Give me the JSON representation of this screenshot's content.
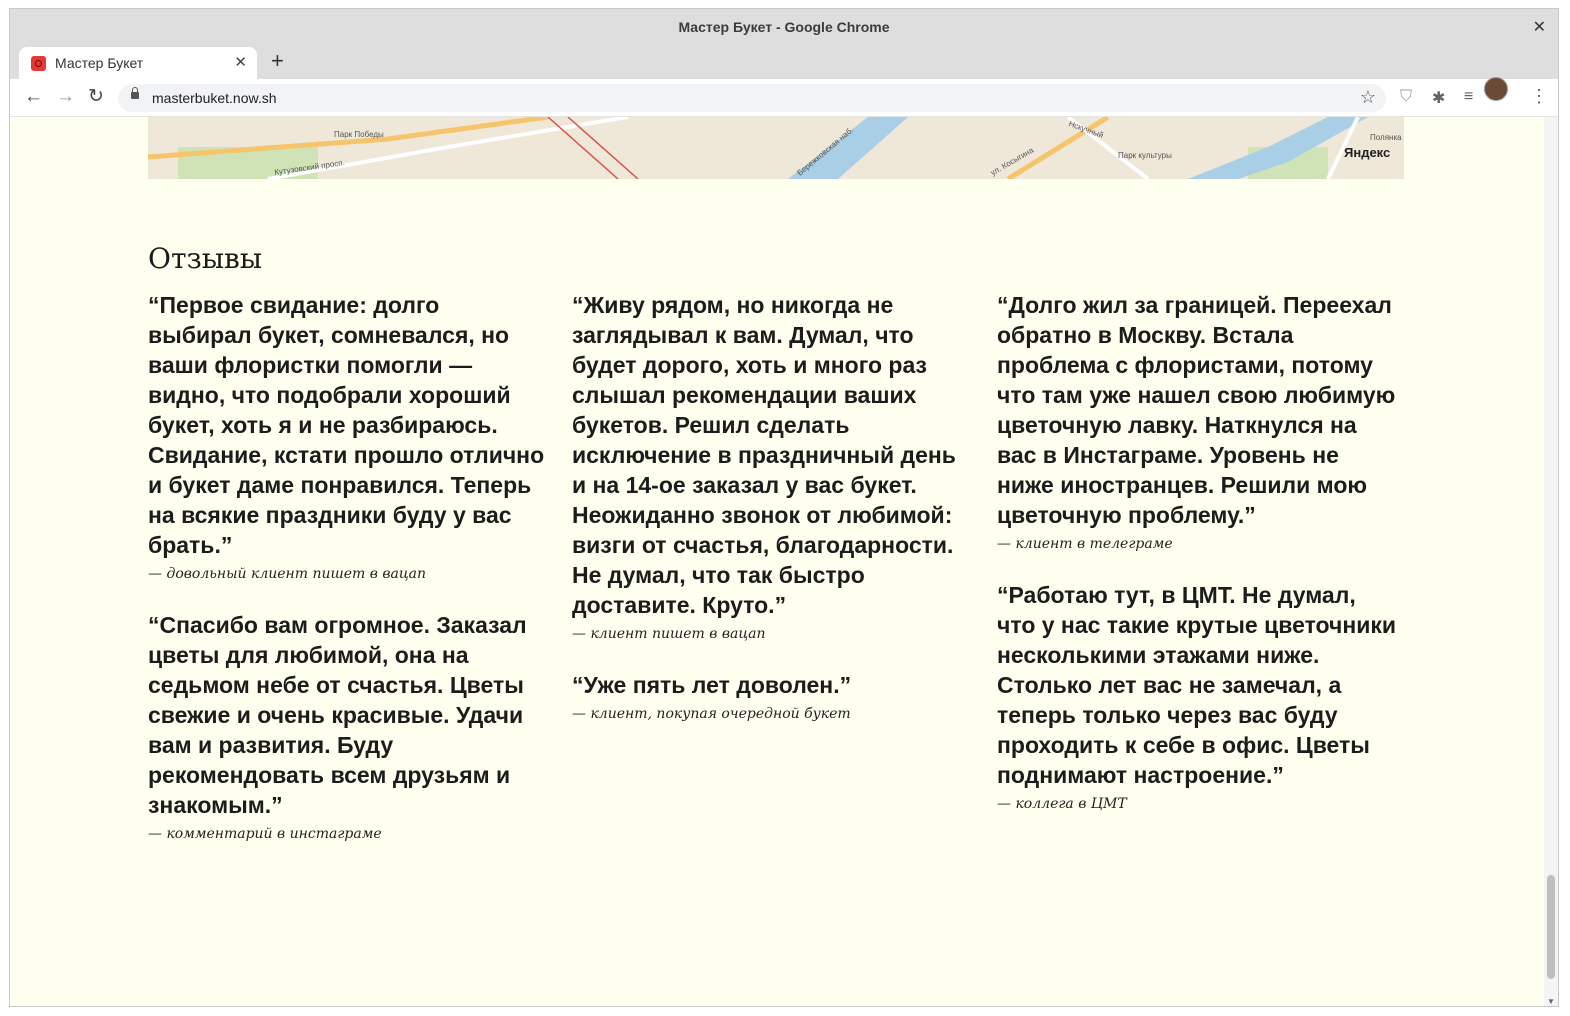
{
  "window": {
    "title": "Мастер Букет - Google Chrome",
    "close_glyph": "✕"
  },
  "tab": {
    "title": "Мастер Букет",
    "close_glyph": "✕",
    "new_tab_glyph": "+"
  },
  "toolbar": {
    "back": "←",
    "forward": "→",
    "reload": "↻",
    "url": "masterbuket.now.sh",
    "star": "☆",
    "menu": "⋮",
    "shield": "⛉",
    "extensions": "✱",
    "media": "≡"
  },
  "map": {
    "labels": [
      "Парк Победы",
      "Кутузовский просп.",
      "Бережковская наб.",
      "Парк культуры",
      "Полянка",
      "Нскучный",
      "ул. Косыгина"
    ],
    "logo": "Яндекс"
  },
  "reviews": {
    "title": "Отзывы",
    "columns": [
      [
        {
          "quote": "“Первое свидание: долго выбирал букет, сомневался, но ваши флористки помогли — видно, что подобрали хороший букет, хоть я и не разбираюсь. Свидание, кстати прошло отлично и букет даме понравился. Теперь на всякие праздники буду у вас брать.”",
          "author": "— довольный клиент пишет в вацап"
        },
        {
          "quote": "“Спасибо вам огромное. Заказал цветы для любимой, она на седьмом небе от счастья. Цветы свежие и очень красивые. Удачи вам и развития. Буду рекомендовать всем друзьям и знакомым.”",
          "author": "— комментарий в инстаграме"
        }
      ],
      [
        {
          "quote": "“Живу рядом, но никогда не заглядывал к вам. Думал, что будет дорого, хоть и много раз слышал рекомендации ваших букетов. Решил сделать исключение в праздничный день и на 14-ое заказал у вас букет. Неожиданно звонок от любимой: визги от счастья, благодарности. Не думал, что так быстро доставите. Круто.”",
          "author": "— клиент пишет в вацап"
        },
        {
          "quote": "“Уже пять лет доволен.”",
          "author": "— клиент, покупая очередной букет"
        }
      ],
      [
        {
          "quote": "“Долго жил за границей. Переехал обратно в Москву. Встала проблема с флористами, потому что там уже нашел свою любимую цветочную лавку. Наткнулся на вас в Инстаграме. Уровень не ниже иностранцев. Решили мою цветочную проблему.”",
          "author": "— клиент в телеграме"
        },
        {
          "quote": "“Работаю тут, в ЦМТ. Не думал, что у нас такие крутые цветочники несколькими этажами ниже. Столько лет вас не замечал, а теперь только через вас буду проходить к себе в офис. Цветы поднимают настроение.”",
          "author": "— коллега в ЦМТ"
        }
      ]
    ]
  }
}
